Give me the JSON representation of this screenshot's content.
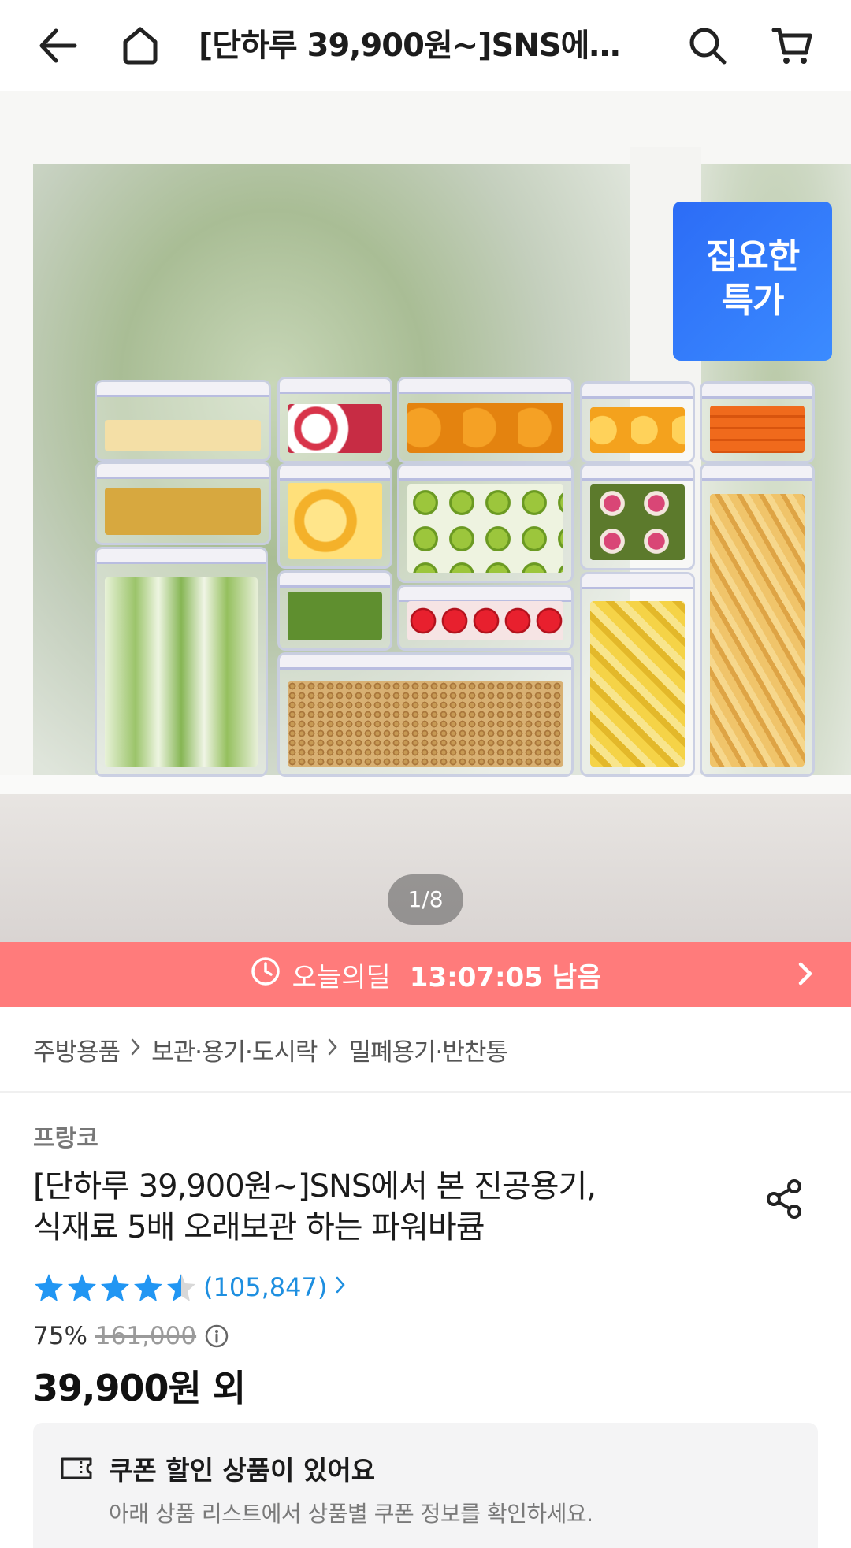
{
  "header": {
    "title": "[단하루 39,900원~]SNS에서 본 진공용기, 식재료 5배 오래보관 하는 파워바큠",
    "icons": [
      "back-arrow-icon",
      "home-icon",
      "search-icon",
      "cart-icon"
    ]
  },
  "hero": {
    "badge_line1": "집요한",
    "badge_line2": "특가",
    "pager": "1/8"
  },
  "deal": {
    "label": "오늘의딜",
    "time": "13:07:05 남음"
  },
  "breadcrumb": [
    "주방용품",
    "보관·용기·도시락",
    "밀폐용기·반찬통"
  ],
  "product": {
    "brand": "프랑코",
    "title_line1": "[단하루 39,900원~]SNS에서 본 진공용기,",
    "title_line2": "식재료 5배 오래보관 하는 파워바큠",
    "rating": 4.5,
    "review_count": "(105,847)",
    "discount": "75%",
    "original_price": "161,000",
    "sale_price": "39,900원 외"
  },
  "coupon": {
    "title": "쿠폰 할인 상품이 있어요",
    "subtitle": "아래 상품 리스트에서 상품별 쿠폰 정보를 확인하세요."
  },
  "colors": {
    "deal_bar": "#ff7b7b",
    "badge": "#2c6cf6",
    "star": "#2196f3",
    "link": "#1e8fe0"
  }
}
